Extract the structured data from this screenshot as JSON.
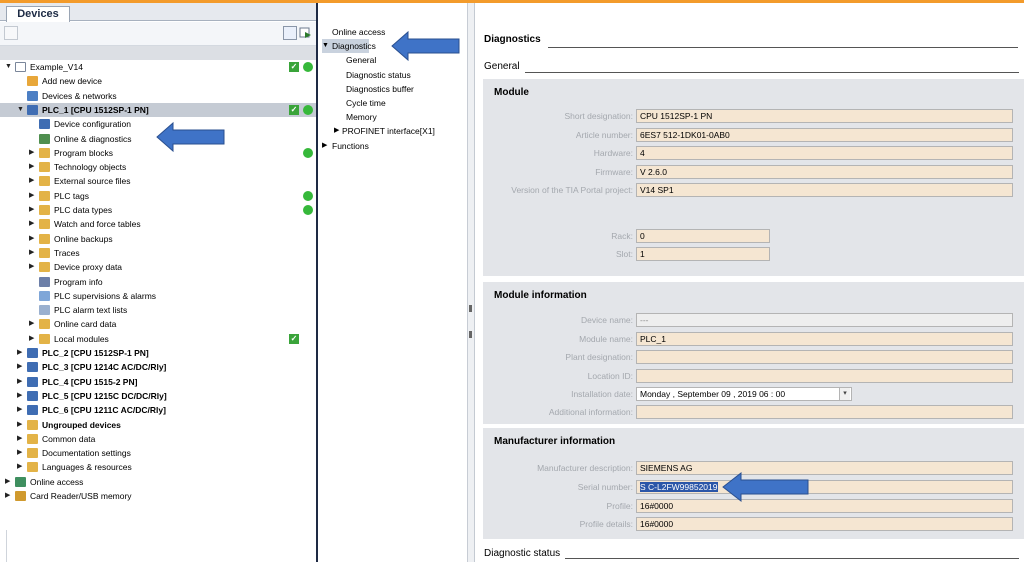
{
  "tree": {
    "tab_label": "Devices",
    "items": [
      {
        "label": "Example_V14",
        "icon": "project-icon",
        "depth": 0,
        "toggle": "open",
        "check": true,
        "dot": true,
        "bold": false
      },
      {
        "label": "Add new device",
        "icon": "add-device-icon",
        "depth": 1,
        "toggle": "none",
        "check": false,
        "dot": false,
        "bold": false
      },
      {
        "label": "Devices & networks",
        "icon": "network-icon",
        "depth": 1,
        "toggle": "none",
        "check": false,
        "dot": false,
        "bold": false
      },
      {
        "label": "PLC_1 [CPU 1512SP-1 PN]",
        "icon": "plc-icon",
        "depth": 1,
        "toggle": "open",
        "check": true,
        "dot": true,
        "bold": true,
        "selected": true
      },
      {
        "label": "Device configuration",
        "icon": "device-config-icon",
        "depth": 2,
        "toggle": "none",
        "check": false,
        "dot": false,
        "bold": false
      },
      {
        "label": "Online & diagnostics",
        "icon": "online-diagnostics-icon",
        "depth": 2,
        "toggle": "none",
        "check": false,
        "dot": false,
        "bold": false,
        "highlight": true
      },
      {
        "label": "Program blocks",
        "icon": "folder-icon",
        "depth": 2,
        "toggle": "closed",
        "check": false,
        "dot": true,
        "bold": false
      },
      {
        "label": "Technology objects",
        "icon": "folder-icon",
        "depth": 2,
        "toggle": "closed",
        "check": false,
        "dot": false,
        "bold": false
      },
      {
        "label": "External source files",
        "icon": "folder-icon",
        "depth": 2,
        "toggle": "closed",
        "check": false,
        "dot": false,
        "bold": false
      },
      {
        "label": "PLC tags",
        "icon": "folder-icon",
        "depth": 2,
        "toggle": "closed",
        "check": false,
        "dot": true,
        "bold": false
      },
      {
        "label": "PLC data types",
        "icon": "folder-icon",
        "depth": 2,
        "toggle": "closed",
        "check": false,
        "dot": true,
        "bold": false
      },
      {
        "label": "Watch and force tables",
        "icon": "folder-icon",
        "depth": 2,
        "toggle": "closed",
        "check": false,
        "dot": false,
        "bold": false
      },
      {
        "label": "Online backups",
        "icon": "folder-icon",
        "depth": 2,
        "toggle": "closed",
        "check": false,
        "dot": false,
        "bold": false
      },
      {
        "label": "Traces",
        "icon": "folder-icon",
        "depth": 2,
        "toggle": "closed",
        "check": false,
        "dot": false,
        "bold": false
      },
      {
        "label": "Device proxy data",
        "icon": "folder-icon",
        "depth": 2,
        "toggle": "closed",
        "check": false,
        "dot": false,
        "bold": false
      },
      {
        "label": "Program info",
        "icon": "program-info-icon",
        "depth": 2,
        "toggle": "none",
        "check": false,
        "dot": false,
        "bold": false
      },
      {
        "label": "PLC supervisions & alarms",
        "icon": "alarms-icon",
        "depth": 2,
        "toggle": "none",
        "check": false,
        "dot": false,
        "bold": false
      },
      {
        "label": "PLC alarm text lists",
        "icon": "text-list-icon",
        "depth": 2,
        "toggle": "none",
        "check": false,
        "dot": false,
        "bold": false
      },
      {
        "label": "Online card data",
        "icon": "folder-icon",
        "depth": 2,
        "toggle": "closed",
        "check": false,
        "dot": false,
        "bold": false
      },
      {
        "label": "Local modules",
        "icon": "folder-icon",
        "depth": 2,
        "toggle": "closed",
        "check": true,
        "dot": false,
        "bold": false
      },
      {
        "label": "PLC_2 [CPU 1512SP-1 PN]",
        "icon": "plc-icon",
        "depth": 1,
        "toggle": "closed",
        "check": false,
        "dot": false,
        "bold": true
      },
      {
        "label": "PLC_3 [CPU 1214C AC/DC/Rly]",
        "icon": "plc-icon",
        "depth": 1,
        "toggle": "closed",
        "check": false,
        "dot": false,
        "bold": true
      },
      {
        "label": "PLC_4 [CPU 1515-2 PN]",
        "icon": "plc-icon",
        "depth": 1,
        "toggle": "closed",
        "check": false,
        "dot": false,
        "bold": true
      },
      {
        "label": "PLC_5 [CPU 1215C DC/DC/Rly]",
        "icon": "plc-icon",
        "depth": 1,
        "toggle": "closed",
        "check": false,
        "dot": false,
        "bold": true
      },
      {
        "label": "PLC_6 [CPU 1211C AC/DC/Rly]",
        "icon": "plc-icon",
        "depth": 1,
        "toggle": "closed",
        "check": false,
        "dot": false,
        "bold": true
      },
      {
        "label": "Ungrouped devices",
        "icon": "folder-icon",
        "depth": 1,
        "toggle": "closed",
        "check": false,
        "dot": false,
        "bold": true
      },
      {
        "label": "Common data",
        "icon": "folder-icon",
        "depth": 1,
        "toggle": "closed",
        "check": false,
        "dot": false,
        "bold": false
      },
      {
        "label": "Documentation settings",
        "icon": "folder-icon",
        "depth": 1,
        "toggle": "closed",
        "check": false,
        "dot": false,
        "bold": false
      },
      {
        "label": "Languages & resources",
        "icon": "folder-icon",
        "depth": 1,
        "toggle": "closed",
        "check": false,
        "dot": false,
        "bold": false
      },
      {
        "label": "Online access",
        "icon": "online-access-icon",
        "depth": 0,
        "toggle": "closed",
        "check": false,
        "dot": false,
        "bold": false
      },
      {
        "label": "Card Reader/USB memory",
        "icon": "card-reader-icon",
        "depth": 0,
        "toggle": "closed",
        "check": false,
        "dot": false,
        "bold": false
      }
    ]
  },
  "nav": {
    "items": [
      {
        "label": "Online access",
        "depth": 0,
        "toggle": "none"
      },
      {
        "label": "Diagnostics",
        "depth": 0,
        "toggle": "open",
        "selected": true
      },
      {
        "label": "General",
        "depth": 1,
        "toggle": "none"
      },
      {
        "label": "Diagnostic status",
        "depth": 1,
        "toggle": "none"
      },
      {
        "label": "Diagnostics buffer",
        "depth": 1,
        "toggle": "none"
      },
      {
        "label": "Cycle time",
        "depth": 1,
        "toggle": "none"
      },
      {
        "label": "Memory",
        "depth": 1,
        "toggle": "none"
      },
      {
        "label": "PROFINET interface[X1]",
        "depth": 1,
        "toggle": "closed"
      },
      {
        "label": "Functions",
        "depth": 0,
        "toggle": "closed"
      }
    ]
  },
  "content": {
    "title": "Diagnostics",
    "general": "General",
    "module": {
      "heading": "Module",
      "short_designation_label": "Short designation:",
      "short_designation": "CPU 1512SP-1 PN",
      "article_number_label": "Article number:",
      "article_number": "6ES7 512-1DK01-0AB0",
      "hardware_label": "Hardware:",
      "hardware": "4",
      "firmware_label": "Firmware:",
      "firmware": "V 2.6.0",
      "tia_version_label": "Version of the TIA Portal project:",
      "tia_version": "V14 SP1",
      "rack_label": "Rack:",
      "rack": "0",
      "slot_label": "Slot:",
      "slot": "1"
    },
    "module_info": {
      "heading": "Module information",
      "device_name_label": "Device name:",
      "device_name": "---",
      "module_name_label": "Module name:",
      "module_name": "PLC_1",
      "plant_designation_label": "Plant designation:",
      "plant_designation": "",
      "location_id_label": "Location ID:",
      "location_id": "",
      "installation_date_label": "Installation date:",
      "installation_date": "Monday , September 09 , 2019 06 : 00",
      "additional_info_label": "Additional information:",
      "additional_info": ""
    },
    "manufacturer": {
      "heading": "Manufacturer information",
      "description_label": "Manufacturer description:",
      "description": "SIEMENS AG",
      "serial_label": "Serial number:",
      "serial": "S C-L2FW99852019",
      "profile_label": "Profile:",
      "profile": "16#0000",
      "profile_details_label": "Profile details:",
      "profile_details": "16#0000"
    },
    "diagnostic_status": "Diagnostic status"
  },
  "colors": {
    "accent_bar": "#f39b2b",
    "arrow": "#3f73c7",
    "status_ok": "#36b83a",
    "field_bg": "#f5e6d2",
    "selection": "#2b56a8"
  }
}
